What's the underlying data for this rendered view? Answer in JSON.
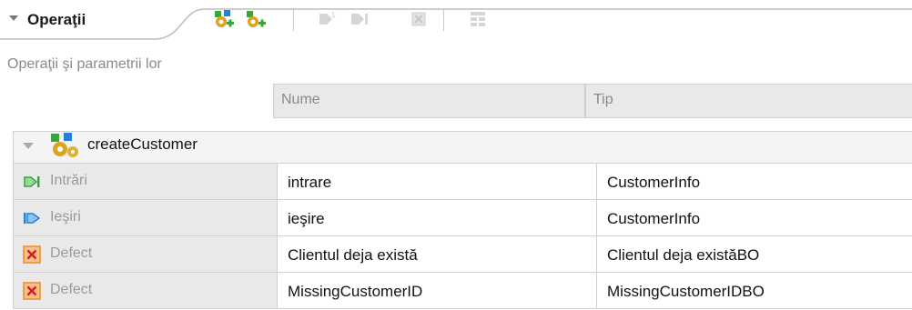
{
  "section": {
    "title": "Operaţii",
    "description": "Operaţii şi parametrii lor",
    "toolbar": [
      "add-operation-icon",
      "add-request-response-icon",
      "add-input-icon",
      "add-output-icon",
      "add-fault-icon",
      "show-details-icon"
    ]
  },
  "table": {
    "columns": [
      "Nume",
      "Tip"
    ],
    "operation": "createCustomer",
    "rows": [
      {
        "kind": "Intrări",
        "icon": "input-icon",
        "name": "intrare",
        "type": "CustomerInfo"
      },
      {
        "kind": "Ieşiri",
        "icon": "output-icon",
        "name": "ieşire",
        "type": "CustomerInfo"
      },
      {
        "kind": "Defect",
        "icon": "fault-icon",
        "name": "Clientul deja există",
        "type": "Clientul deja existăBO"
      },
      {
        "kind": "Defect",
        "icon": "fault-icon",
        "name": "MissingCustomerID",
        "type": "MissingCustomerIDBO"
      }
    ]
  },
  "colors": {
    "header_bg": "#e9e9e9",
    "border": "#cfcfcf",
    "label_gray": "#8a8a8a",
    "fault_orange": "#f08a24",
    "input_green": "#3aa63a",
    "output_blue": "#2a7fd4"
  }
}
